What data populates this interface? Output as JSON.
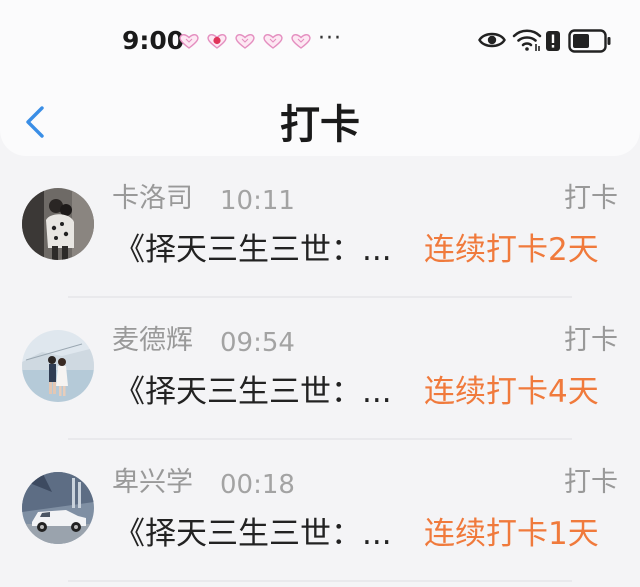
{
  "status_bar": {
    "time": "9:00",
    "more": "···",
    "notification_icons": [
      "heart-notification-icon",
      "heart-badge-notification-icon",
      "heart-notification-icon",
      "heart-notification-icon",
      "heart-notification-icon"
    ],
    "system_icons": [
      "eye-icon",
      "wifi-icon",
      "alert-icon",
      "battery-icon"
    ]
  },
  "header": {
    "back_icon": "chevron-left-icon",
    "title": "打卡"
  },
  "colors": {
    "accent": "#f07a3c",
    "back": "#3a8ee6",
    "muted": "#999999",
    "text": "#222222"
  },
  "list": [
    {
      "name": "卡洛司",
      "time": "10:11",
      "action": "打卡",
      "content": "《择天三生三世：...",
      "streak": "连续打卡2天",
      "avatar": "couple-photo-avatar"
    },
    {
      "name": "麦德辉",
      "time": "09:54",
      "action": "打卡",
      "content": "《择天三生三世：...",
      "streak": "连续打卡4天",
      "avatar": "seaside-couple-avatar"
    },
    {
      "name": "卑兴学",
      "time": "00:18",
      "action": "打卡",
      "content": "《择天三生三世：...",
      "streak": "连续打卡1天",
      "avatar": "white-car-avatar"
    }
  ]
}
